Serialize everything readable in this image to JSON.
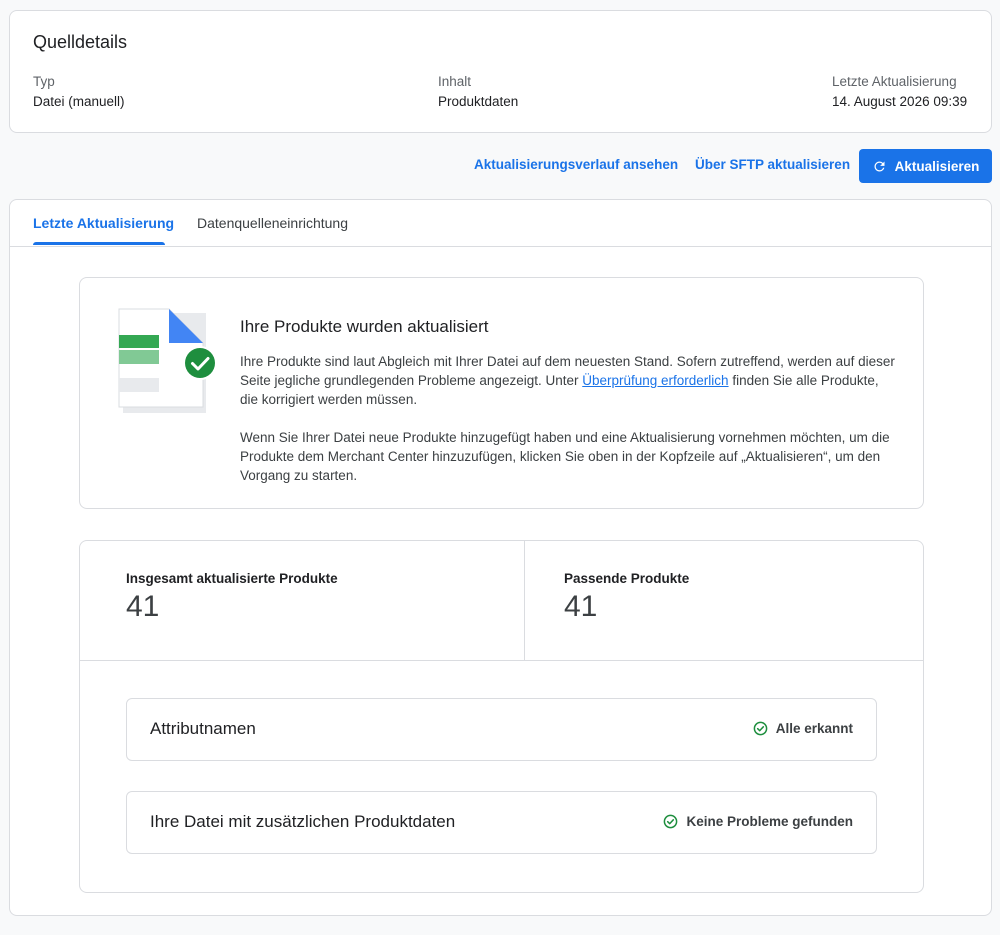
{
  "source_details": {
    "title": "Quelldetails",
    "fields": [
      {
        "label": "Typ",
        "value": "Datei (manuell)"
      },
      {
        "label": "Inhalt",
        "value": "Produktdaten"
      },
      {
        "label": "Letzte Aktualisierung",
        "value": "14. August 2026 09:39"
      }
    ]
  },
  "actions": {
    "history_label": "Aktualisierungsverlauf ansehen",
    "sftp_label": "Über SFTP aktualisieren",
    "update_label": "Aktualisieren"
  },
  "tabs": [
    {
      "label": "Letzte Aktualisierung",
      "active": true
    },
    {
      "label": "Datenquelleneinrichtung",
      "active": false
    }
  ],
  "info": {
    "heading": "Ihre Produkte wurden aktualisiert",
    "para1_before": "Ihre Produkte sind laut Abgleich mit Ihrer Datei auf dem neuesten Stand. Sofern zutreffend, werden auf dieser Seite jegliche grundlegenden Probleme angezeigt. Unter ",
    "para1_link": "Überprüfung erforderlich",
    "para1_after": " finden Sie alle Produkte, die korrigiert werden müssen.",
    "para2": "Wenn Sie Ihrer Datei neue Produkte hinzugefügt haben und eine Aktualisierung vornehmen möchten, um die Produkte dem Merchant Center hinzuzufügen, klicken Sie oben in der Kopfzeile auf „Aktualisieren“, um den Vorgang zu starten."
  },
  "stats": [
    {
      "label": "Insgesamt aktualisierte Produkte",
      "value": "41"
    },
    {
      "label": "Passende Produkte",
      "value": "41"
    }
  ],
  "status_rows": [
    {
      "name": "Attributnamen",
      "status": "Alle erkannt"
    },
    {
      "name": "Ihre Datei mit zusätzlichen Produktdaten",
      "status": "Keine Probleme gefunden"
    }
  ],
  "colors": {
    "accent": "#1a73e8",
    "success": "#1e8e3e"
  }
}
